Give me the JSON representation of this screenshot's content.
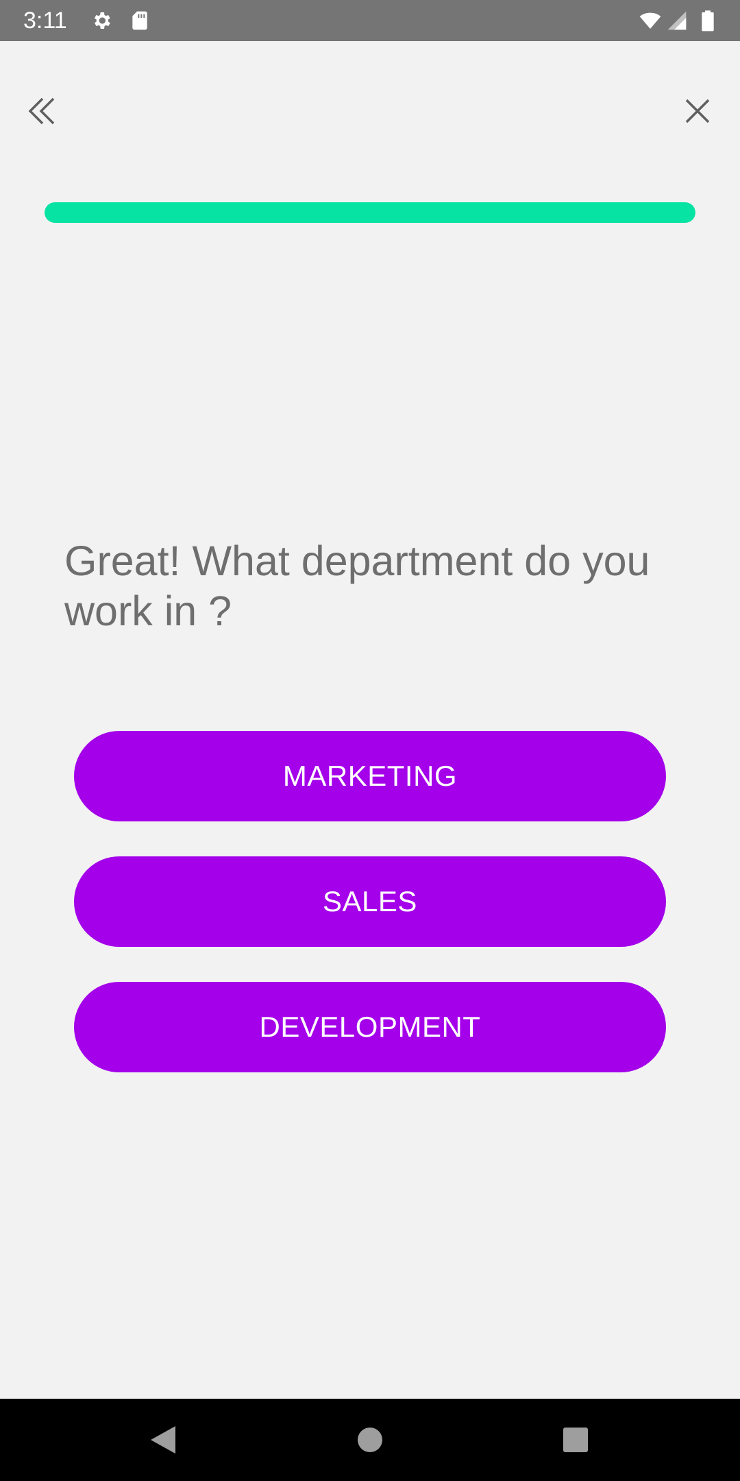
{
  "status_bar": {
    "time": "3:11",
    "icons": [
      "gear-icon",
      "sd-card-icon",
      "wifi-icon",
      "signal-icon",
      "battery-icon"
    ]
  },
  "header": {
    "back_icon": "double-chevron-left-icon",
    "close_icon": "close-icon"
  },
  "progress": {
    "value": 1.0,
    "color": "#06e3a2"
  },
  "question": {
    "text": "Great! What department do you work in ?"
  },
  "options": [
    {
      "label": "MARKETING"
    },
    {
      "label": "SALES"
    },
    {
      "label": "DEVELOPMENT"
    }
  ],
  "colors": {
    "accent": "#a400ea",
    "progress": "#06e3a2",
    "background": "#f2f2f2",
    "text": "#6e6e6e"
  },
  "system_nav": {
    "icons": [
      "back-triangle-icon",
      "home-circle-icon",
      "recents-square-icon"
    ]
  }
}
